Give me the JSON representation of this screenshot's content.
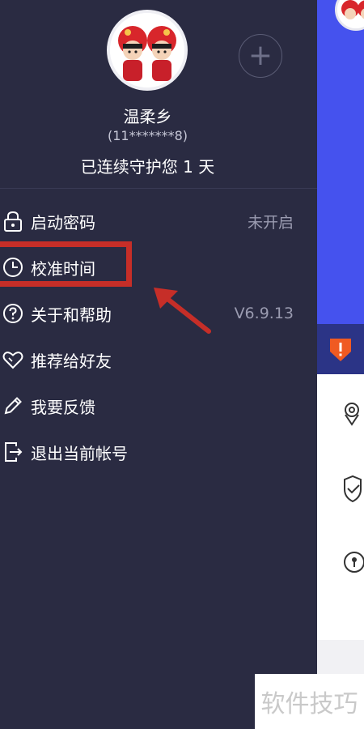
{
  "user": {
    "name": "温柔乡",
    "phone": "(11*******8)",
    "guard_text": "已连续守护您 1 天",
    "add_symbol": "+"
  },
  "menu": [
    {
      "label": "启动密码",
      "value": "未开启",
      "icon": "lock-icon"
    },
    {
      "label": "校准时间",
      "value": "",
      "icon": "clock-icon"
    },
    {
      "label": "关于和帮助",
      "value": "V6.9.13",
      "icon": "help-icon"
    },
    {
      "label": "推荐给好友",
      "value": "",
      "icon": "heart-icon"
    },
    {
      "label": "我要反馈",
      "value": "",
      "icon": "pencil-icon"
    },
    {
      "label": "退出当前帐号",
      "value": "",
      "icon": "logout-icon"
    }
  ],
  "watermark": "软件技巧",
  "colors": {
    "drawer_bg": "#2a2b42",
    "accent_blue": "#4552ee",
    "dark_blue_bar": "#2b3486",
    "highlight_red": "#c62e28",
    "alert_orange": "#f05a22"
  }
}
